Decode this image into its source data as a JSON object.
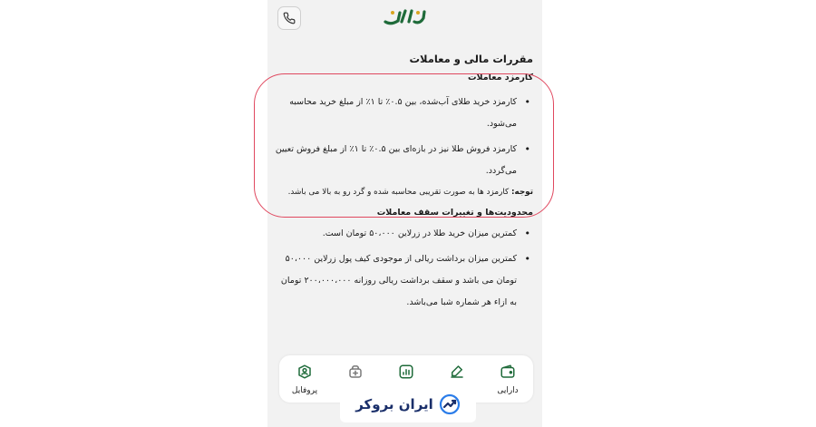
{
  "header": {
    "logo_text": "زرلاین",
    "icons": [
      "phone-icon"
    ]
  },
  "content": {
    "section_title": "مقررات مالی و معاملات",
    "subsection1_title": "کارمزد معاملات",
    "fee_items": [
      "کارمزد خرید طلای آب‌شده، بین ۰.۵٪ تا ۱٪ از مبلغ خرید محاسبه می‌شود.",
      "کارمزد فروش طلا نیز در بازه‌ای بین ۰.۵٪ تا ۱٪ از مبلغ فروش تعیین می‌گردد."
    ],
    "note_label": "توجه:",
    "note_text": " کارمزد ها به صورت تقریبی محاسبه شده و گرد رو به بالا می باشد.",
    "subsection2_title": "محدودیت‌ها و تغییرات سقف معاملات",
    "limit_items": [
      "کمترین میزان خرید طلا در زرلاین ۵۰،۰۰۰ تومان است.",
      "کمترین میزان برداشت ریالی از موجودی کیف پول زرلاین ۵۰،۰۰۰ تومان می باشد و سقف برداشت ریالی روزانه ۲۰۰،۰۰۰،۰۰۰ تومان به ازاء هر شماره شبا می‌باشد."
    ]
  },
  "navbar": {
    "items": [
      {
        "label": "دارایی",
        "icon": "wallet-icon"
      },
      {
        "label": "",
        "icon": "edit-icon"
      },
      {
        "label": "",
        "icon": "chart-icon"
      },
      {
        "label": "",
        "icon": "gift-icon"
      },
      {
        "label": "پروفایل",
        "icon": "profile-icon"
      }
    ]
  },
  "watermark": {
    "text": "ایران بروکر",
    "icon": "broker-logo-icon"
  },
  "colors": {
    "brand_green": "#1f6b3a",
    "logo_gold": "#d9a520",
    "highlight": "#e0485f",
    "watermark_blue": "#1a2f6a"
  }
}
